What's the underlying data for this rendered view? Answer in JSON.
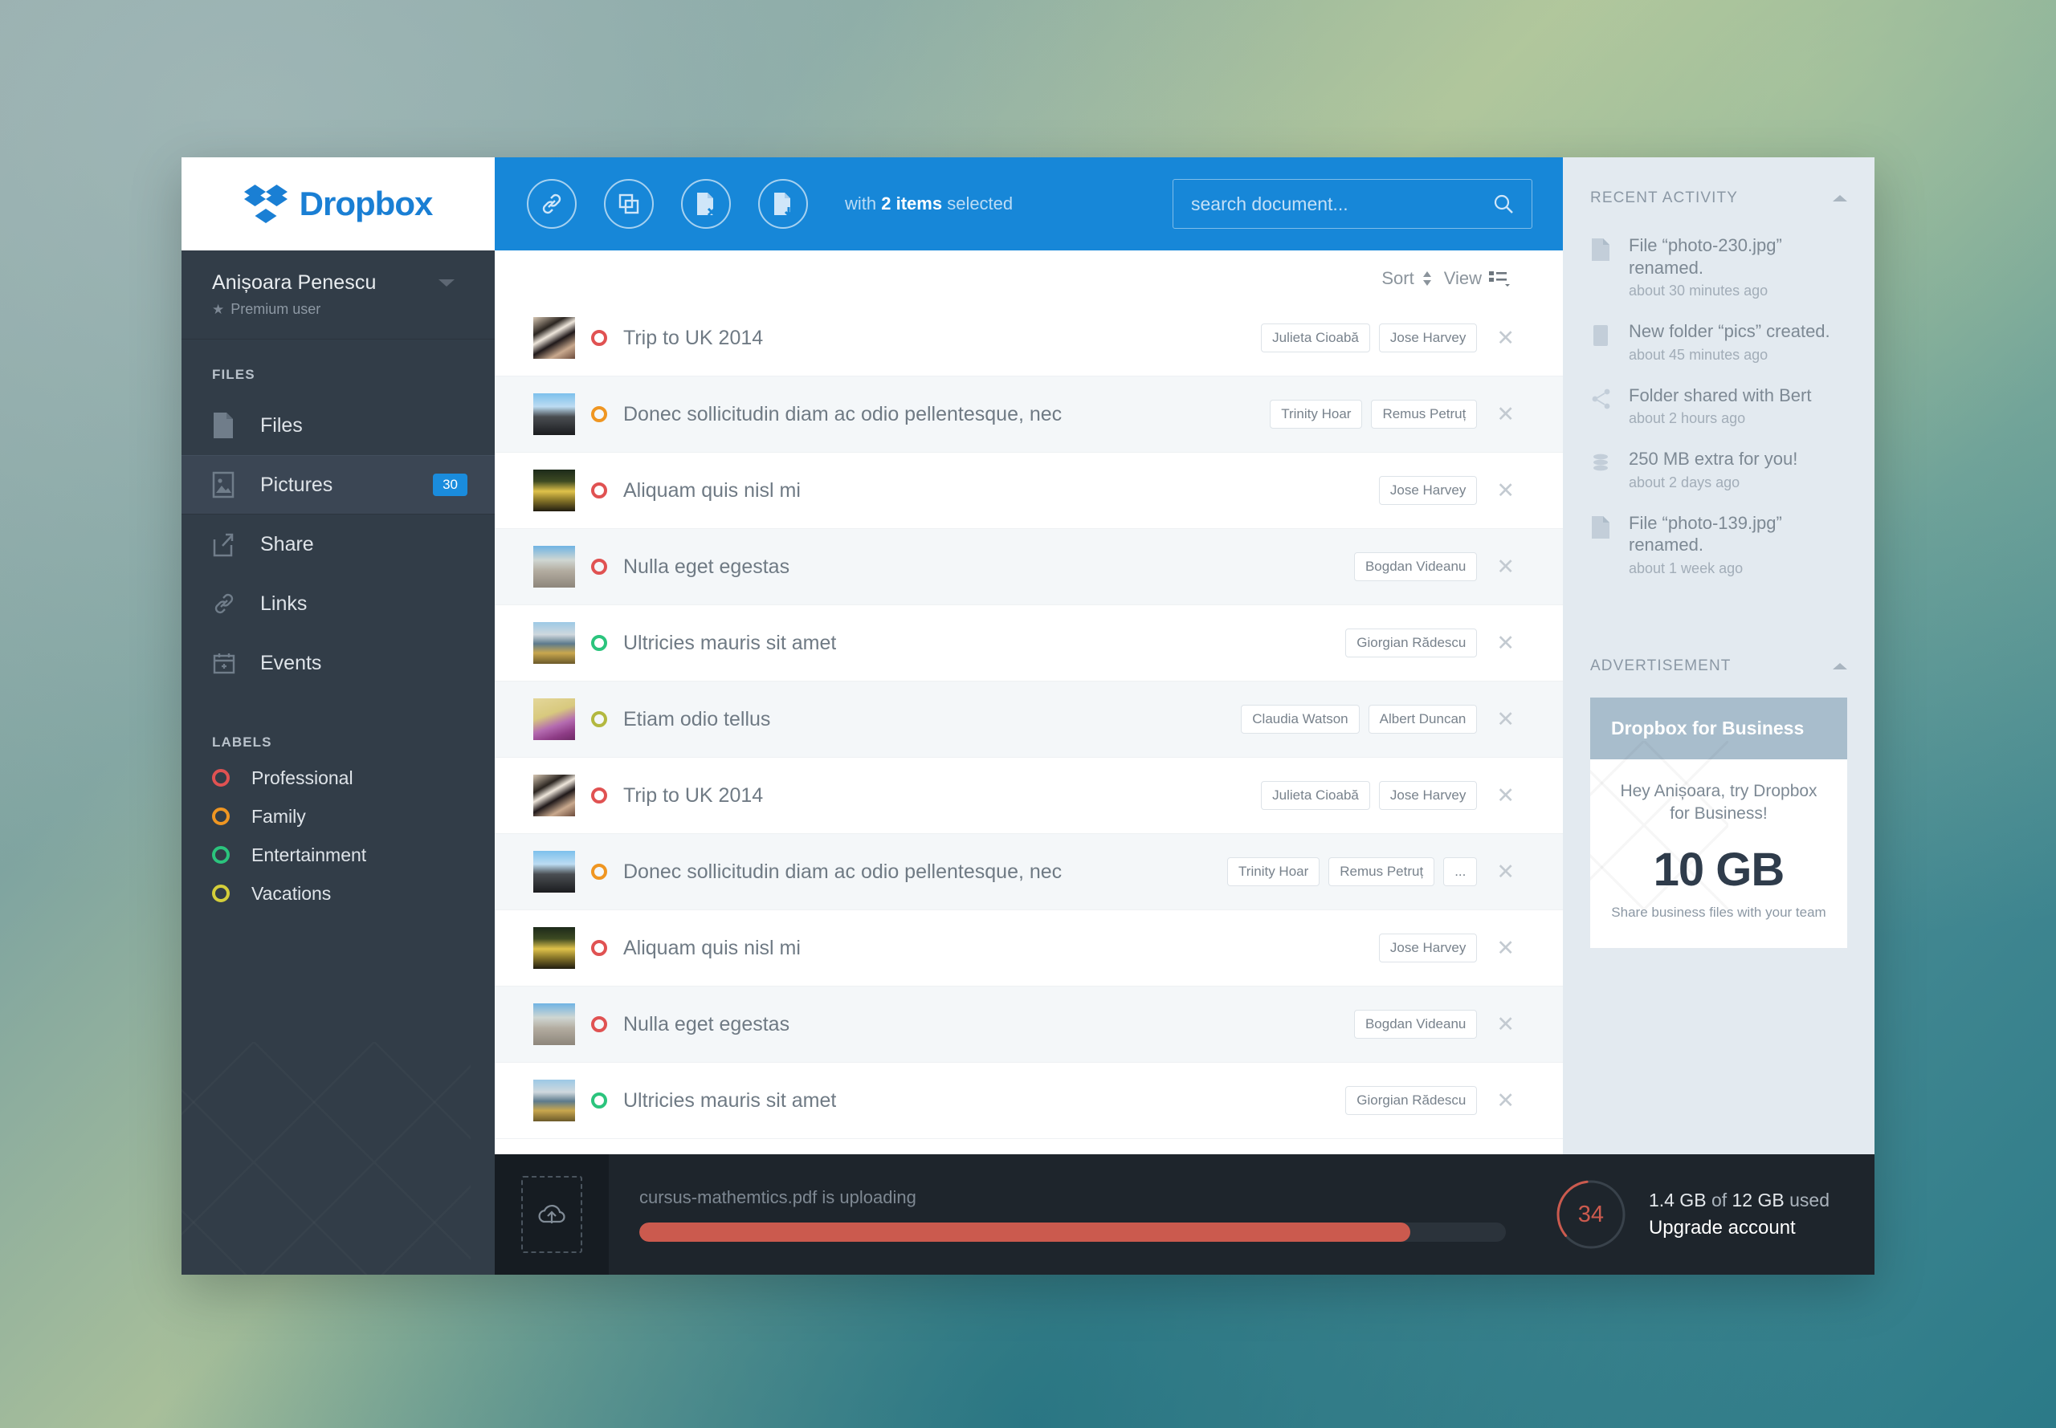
{
  "brand": {
    "name": "Dropbox",
    "color": "#1a7fd4"
  },
  "user": {
    "name": "Anișoara Penescu",
    "plan": "Premium user"
  },
  "sidebar": {
    "files_heading": "FILES",
    "nav": [
      {
        "label": "Files",
        "icon": "file-icon",
        "badge": ""
      },
      {
        "label": "Pictures",
        "icon": "picture-icon",
        "badge": "30"
      },
      {
        "label": "Share",
        "icon": "share-icon",
        "badge": ""
      },
      {
        "label": "Links",
        "icon": "link-icon",
        "badge": ""
      },
      {
        "label": "Events",
        "icon": "calendar-icon",
        "badge": ""
      }
    ],
    "labels_heading": "LABELS",
    "labels": [
      {
        "label": "Professional",
        "color": "#e05252"
      },
      {
        "label": "Family",
        "color": "#ef9622"
      },
      {
        "label": "Entertainment",
        "color": "#2bc47d"
      },
      {
        "label": "Vacations",
        "color": "#d4ce3a"
      }
    ]
  },
  "toolbar": {
    "icons": [
      "link-icon",
      "copy-icon",
      "file-delete-icon",
      "file-download-icon"
    ],
    "selection_prefix": "with",
    "selection_count": "2 items",
    "selection_suffix": "selected"
  },
  "search": {
    "placeholder": "search document...",
    "value": "",
    "icon": "search-icon"
  },
  "list_controls": {
    "sort_label": "Sort",
    "view_label": "View"
  },
  "files": [
    {
      "title": "Trip to UK 2014",
      "ring": "#e05252",
      "thumb": "piano",
      "tags": [
        "Julieta Cioabă",
        "Jose Harvey"
      ]
    },
    {
      "title": "Donec sollicitudin diam ac odio pellentesque, nec",
      "ring": "#ef9622",
      "thumb": "eiffel",
      "tags": [
        "Trinity Hoar",
        "Remus Petruț"
      ]
    },
    {
      "title": "Aliquam quis nisl mi",
      "ring": "#e05252",
      "thumb": "night",
      "tags": [
        "Jose Harvey"
      ]
    },
    {
      "title": "Nulla eget egestas",
      "ring": "#e05252",
      "thumb": "cathedral",
      "tags": [
        "Bogdan Videanu"
      ]
    },
    {
      "title": "Ultricies mauris sit amet",
      "ring": "#2bc47d",
      "thumb": "river",
      "tags": [
        "Giorgian Rădescu"
      ]
    },
    {
      "title": "Etiam odio tellus",
      "ring": "#b3b840",
      "thumb": "flowers",
      "tags": [
        "Claudia Watson",
        "Albert Duncan"
      ]
    },
    {
      "title": "Trip to UK 2014",
      "ring": "#e05252",
      "thumb": "piano",
      "tags": [
        "Julieta Cioabă",
        "Jose Harvey"
      ]
    },
    {
      "title": "Donec sollicitudin diam ac odio pellentesque, nec",
      "ring": "#ef9622",
      "thumb": "eiffel",
      "tags": [
        "Trinity Hoar",
        "Remus Petruț",
        "..."
      ]
    },
    {
      "title": "Aliquam quis nisl mi",
      "ring": "#e05252",
      "thumb": "night",
      "tags": [
        "Jose Harvey"
      ]
    },
    {
      "title": "Nulla eget egestas",
      "ring": "#e05252",
      "thumb": "cathedral",
      "tags": [
        "Bogdan Videanu"
      ]
    },
    {
      "title": "Ultricies mauris sit amet",
      "ring": "#2bc47d",
      "thumb": "river",
      "tags": [
        "Giorgian Rădescu"
      ]
    }
  ],
  "recent_activity": {
    "title": "RECENT ACTIVITY",
    "items": [
      {
        "text": "File “photo-230.jpg” renamed.",
        "time": "about 30 minutes ago",
        "icon": "file-icon"
      },
      {
        "text": "New folder “pics” created.",
        "time": "about 45 minutes ago",
        "icon": "folder-icon"
      },
      {
        "text": "Folder shared with Bert",
        "time": "about 2 hours ago",
        "icon": "share-icon"
      },
      {
        "text": "250 MB extra for you!",
        "time": "about 2 days ago",
        "icon": "database-icon"
      },
      {
        "text": "File “photo-139.jpg” renamed.",
        "time": "about 1 week ago",
        "icon": "file-icon"
      }
    ]
  },
  "advertisement": {
    "title": "ADVERTISEMENT",
    "header": "Dropbox for Business",
    "lead": "Hey Anișoara, try Dropbox for Business!",
    "big": "10 GB",
    "footer": "Share business files with your team"
  },
  "upload": {
    "filename": "cursus-mathemtics.pdf",
    "status": "is uploading",
    "progress_percent": 89,
    "drop_icon": "upload-cloud-icon"
  },
  "storage": {
    "percent": "34",
    "used_value": "1.4 GB",
    "of_label": "of",
    "total_value": "12 GB",
    "used_label": "used",
    "upgrade": "Upgrade account",
    "accent": "#cb5a4e"
  }
}
